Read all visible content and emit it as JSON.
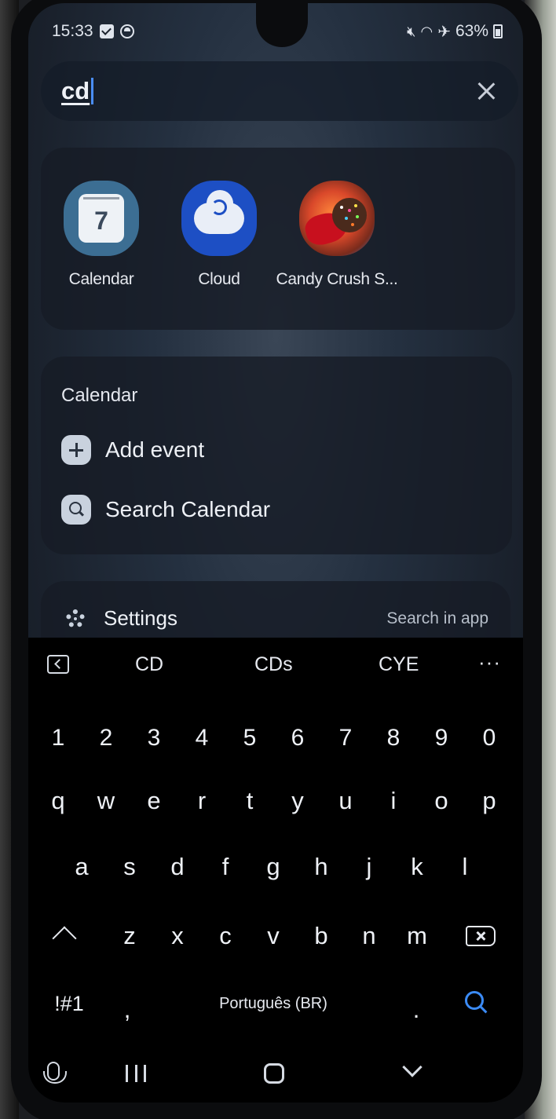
{
  "status_bar": {
    "time": "15:33",
    "battery": "63%"
  },
  "search": {
    "query": "cd"
  },
  "apps": [
    {
      "label": "Calendar",
      "icon": "calendar-icon",
      "day": "7"
    },
    {
      "label": "Cloud",
      "icon": "cloud-icon"
    },
    {
      "label": "Candy Crush S...",
      "icon": "candy-crush-icon"
    }
  ],
  "calendar_section": {
    "title": "Calendar",
    "actions": [
      {
        "label": "Add event",
        "icon": "plus-icon"
      },
      {
        "label": "Search Calendar",
        "icon": "search-icon"
      }
    ]
  },
  "settings_section": {
    "label": "Settings",
    "hint": "Search in app"
  },
  "keyboard": {
    "suggestions": [
      "CD",
      "CDs",
      "CYE"
    ],
    "more": "···",
    "number_row": [
      "1",
      "2",
      "3",
      "4",
      "5",
      "6",
      "7",
      "8",
      "9",
      "0"
    ],
    "row1": [
      "q",
      "w",
      "e",
      "r",
      "t",
      "y",
      "u",
      "i",
      "o",
      "p"
    ],
    "row2": [
      "a",
      "s",
      "d",
      "f",
      "g",
      "h",
      "j",
      "k",
      "l"
    ],
    "row3": [
      "z",
      "x",
      "c",
      "v",
      "b",
      "n",
      "m"
    ],
    "symbols_key": "!#1",
    "comma": ",",
    "space_label": "Português (BR)",
    "period": "."
  },
  "colors": {
    "accent": "#3b8bf6",
    "keyboard_bg": "#000000"
  }
}
